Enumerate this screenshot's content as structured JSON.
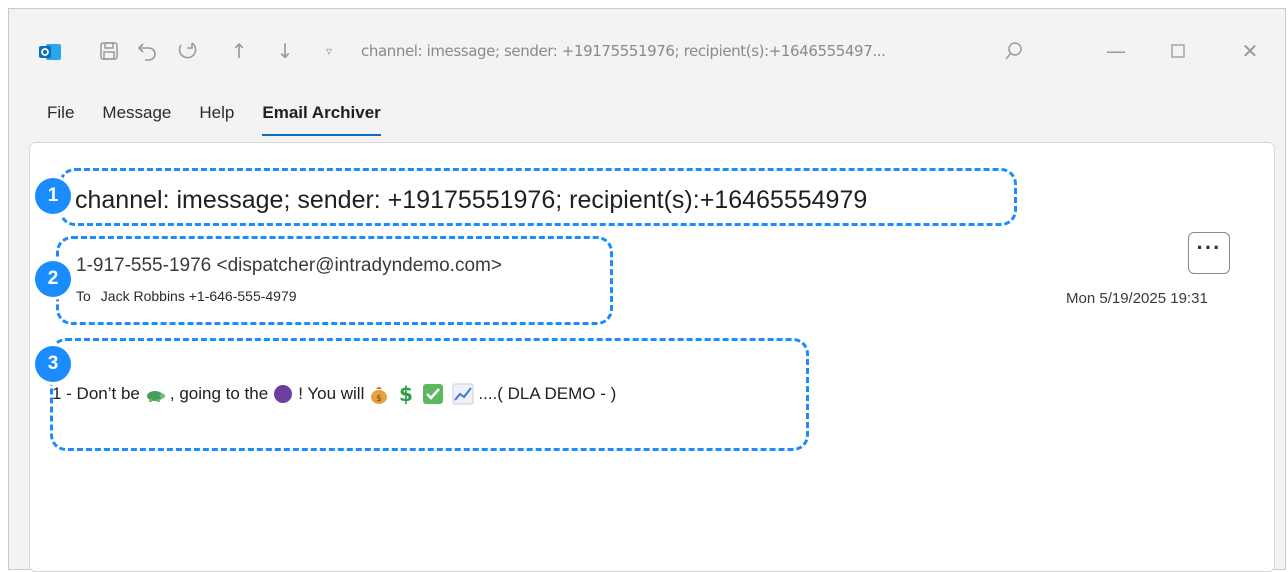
{
  "window": {
    "title": "channel: imessage; sender: +19175551976; recipient(s):+1646555497..."
  },
  "titlebar": {
    "icons": [
      "outlook-icon",
      "save-icon",
      "undo-icon",
      "redo-icon",
      "up-arrow-icon",
      "down-arrow-icon",
      "customize-toolbar-icon",
      "search-icon",
      "minimize-icon",
      "maximize-icon",
      "close-icon"
    ]
  },
  "ribbon": {
    "tabs": [
      {
        "label": "File"
      },
      {
        "label": "Message"
      },
      {
        "label": "Help"
      },
      {
        "label": "Email Archiver",
        "active": true
      }
    ]
  },
  "message": {
    "subject": "channel: imessage; sender: +19175551976; recipient(s):+16465554979",
    "sender": "1-917-555-1976 <dispatcher@intradyndemo.com>",
    "to_label": "To",
    "to_value": "Jack Robbins +1-646-555-4979",
    "date": "Mon 5/19/2025 19:31",
    "more_label": "···",
    "body": {
      "part1": "1 - Don’t be ",
      "part2": ", going to the ",
      "part3": "! You will ",
      "part4": "....( DLA DEMO - )"
    }
  },
  "annotations": {
    "badges": [
      "1",
      "2",
      "3"
    ],
    "color": "#1a8cff"
  },
  "colors": {
    "accent": "#0f6cbd",
    "outlook_blue": "#0f6cbd"
  }
}
